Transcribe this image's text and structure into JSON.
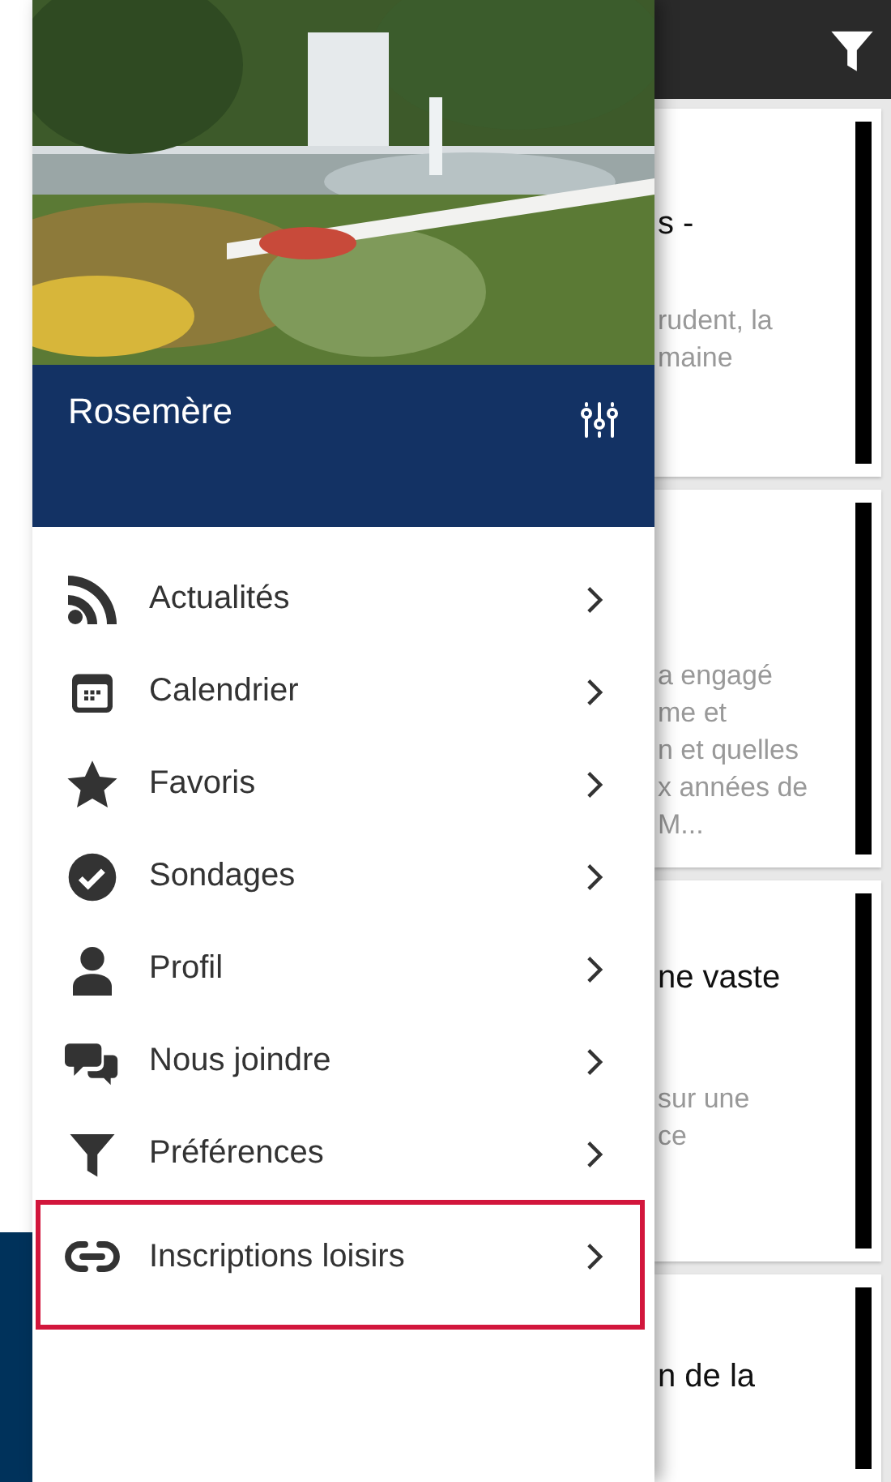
{
  "drawer": {
    "header": {
      "kind": "picture",
      "title": "Rosemère"
    },
    "items": [
      {
        "label": "Actualités",
        "kind": "rss",
        "highlighted": false
      },
      {
        "label": "Calendrier",
        "kind": "calendar",
        "highlighted": false
      },
      {
        "label": "Favoris",
        "kind": "star",
        "highlighted": false
      },
      {
        "label": "Sondages",
        "kind": "check",
        "highlighted": false
      },
      {
        "label": "Profil",
        "kind": "person",
        "highlighted": false
      },
      {
        "label": "Nous joindre",
        "kind": "chat",
        "highlighted": false
      },
      {
        "label": "Préférences",
        "kind": "filter",
        "highlighted": false
      },
      {
        "label": "Inscriptions loisirs",
        "kind": "link",
        "highlighted": true
      }
    ]
  },
  "feed": {
    "cards": [
      {
        "title": [
          "s -"
        ],
        "summary": [
          "rudent, la",
          "maine"
        ]
      },
      {
        "summary": [
          "a engagé",
          "me et",
          "n et quelles",
          "x années de",
          "M..."
        ]
      },
      {
        "title": [
          "ne vaste"
        ],
        "summary": [
          "sur une",
          "ce"
        ]
      },
      {
        "title": [
          "n de la"
        ]
      }
    ]
  }
}
